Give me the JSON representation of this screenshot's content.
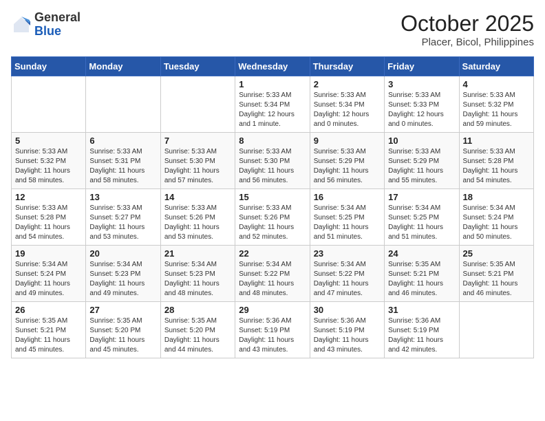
{
  "header": {
    "logo_general": "General",
    "logo_blue": "Blue",
    "month_title": "October 2025",
    "location": "Placer, Bicol, Philippines"
  },
  "weekdays": [
    "Sunday",
    "Monday",
    "Tuesday",
    "Wednesday",
    "Thursday",
    "Friday",
    "Saturday"
  ],
  "weeks": [
    [
      {
        "day": "",
        "info": ""
      },
      {
        "day": "",
        "info": ""
      },
      {
        "day": "",
        "info": ""
      },
      {
        "day": "1",
        "info": "Sunrise: 5:33 AM\nSunset: 5:34 PM\nDaylight: 12 hours\nand 1 minute."
      },
      {
        "day": "2",
        "info": "Sunrise: 5:33 AM\nSunset: 5:34 PM\nDaylight: 12 hours\nand 0 minutes."
      },
      {
        "day": "3",
        "info": "Sunrise: 5:33 AM\nSunset: 5:33 PM\nDaylight: 12 hours\nand 0 minutes."
      },
      {
        "day": "4",
        "info": "Sunrise: 5:33 AM\nSunset: 5:32 PM\nDaylight: 11 hours\nand 59 minutes."
      }
    ],
    [
      {
        "day": "5",
        "info": "Sunrise: 5:33 AM\nSunset: 5:32 PM\nDaylight: 11 hours\nand 58 minutes."
      },
      {
        "day": "6",
        "info": "Sunrise: 5:33 AM\nSunset: 5:31 PM\nDaylight: 11 hours\nand 58 minutes."
      },
      {
        "day": "7",
        "info": "Sunrise: 5:33 AM\nSunset: 5:30 PM\nDaylight: 11 hours\nand 57 minutes."
      },
      {
        "day": "8",
        "info": "Sunrise: 5:33 AM\nSunset: 5:30 PM\nDaylight: 11 hours\nand 56 minutes."
      },
      {
        "day": "9",
        "info": "Sunrise: 5:33 AM\nSunset: 5:29 PM\nDaylight: 11 hours\nand 56 minutes."
      },
      {
        "day": "10",
        "info": "Sunrise: 5:33 AM\nSunset: 5:29 PM\nDaylight: 11 hours\nand 55 minutes."
      },
      {
        "day": "11",
        "info": "Sunrise: 5:33 AM\nSunset: 5:28 PM\nDaylight: 11 hours\nand 54 minutes."
      }
    ],
    [
      {
        "day": "12",
        "info": "Sunrise: 5:33 AM\nSunset: 5:28 PM\nDaylight: 11 hours\nand 54 minutes."
      },
      {
        "day": "13",
        "info": "Sunrise: 5:33 AM\nSunset: 5:27 PM\nDaylight: 11 hours\nand 53 minutes."
      },
      {
        "day": "14",
        "info": "Sunrise: 5:33 AM\nSunset: 5:26 PM\nDaylight: 11 hours\nand 53 minutes."
      },
      {
        "day": "15",
        "info": "Sunrise: 5:33 AM\nSunset: 5:26 PM\nDaylight: 11 hours\nand 52 minutes."
      },
      {
        "day": "16",
        "info": "Sunrise: 5:34 AM\nSunset: 5:25 PM\nDaylight: 11 hours\nand 51 minutes."
      },
      {
        "day": "17",
        "info": "Sunrise: 5:34 AM\nSunset: 5:25 PM\nDaylight: 11 hours\nand 51 minutes."
      },
      {
        "day": "18",
        "info": "Sunrise: 5:34 AM\nSunset: 5:24 PM\nDaylight: 11 hours\nand 50 minutes."
      }
    ],
    [
      {
        "day": "19",
        "info": "Sunrise: 5:34 AM\nSunset: 5:24 PM\nDaylight: 11 hours\nand 49 minutes."
      },
      {
        "day": "20",
        "info": "Sunrise: 5:34 AM\nSunset: 5:23 PM\nDaylight: 11 hours\nand 49 minutes."
      },
      {
        "day": "21",
        "info": "Sunrise: 5:34 AM\nSunset: 5:23 PM\nDaylight: 11 hours\nand 48 minutes."
      },
      {
        "day": "22",
        "info": "Sunrise: 5:34 AM\nSunset: 5:22 PM\nDaylight: 11 hours\nand 48 minutes."
      },
      {
        "day": "23",
        "info": "Sunrise: 5:34 AM\nSunset: 5:22 PM\nDaylight: 11 hours\nand 47 minutes."
      },
      {
        "day": "24",
        "info": "Sunrise: 5:35 AM\nSunset: 5:21 PM\nDaylight: 11 hours\nand 46 minutes."
      },
      {
        "day": "25",
        "info": "Sunrise: 5:35 AM\nSunset: 5:21 PM\nDaylight: 11 hours\nand 46 minutes."
      }
    ],
    [
      {
        "day": "26",
        "info": "Sunrise: 5:35 AM\nSunset: 5:21 PM\nDaylight: 11 hours\nand 45 minutes."
      },
      {
        "day": "27",
        "info": "Sunrise: 5:35 AM\nSunset: 5:20 PM\nDaylight: 11 hours\nand 45 minutes."
      },
      {
        "day": "28",
        "info": "Sunrise: 5:35 AM\nSunset: 5:20 PM\nDaylight: 11 hours\nand 44 minutes."
      },
      {
        "day": "29",
        "info": "Sunrise: 5:36 AM\nSunset: 5:19 PM\nDaylight: 11 hours\nand 43 minutes."
      },
      {
        "day": "30",
        "info": "Sunrise: 5:36 AM\nSunset: 5:19 PM\nDaylight: 11 hours\nand 43 minutes."
      },
      {
        "day": "31",
        "info": "Sunrise: 5:36 AM\nSunset: 5:19 PM\nDaylight: 11 hours\nand 42 minutes."
      },
      {
        "day": "",
        "info": ""
      }
    ]
  ]
}
